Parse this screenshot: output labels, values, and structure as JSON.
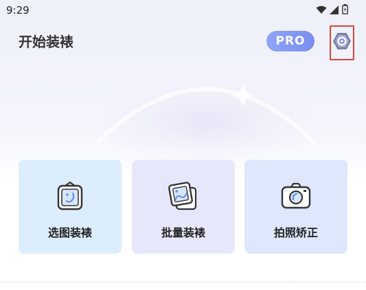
{
  "status_bar": {
    "time": "9:29",
    "icons": [
      "wifi-icon",
      "signal-icon",
      "battery-icon"
    ]
  },
  "header": {
    "title": "开始装裱",
    "pro_label": "PRO",
    "settings_icon": "settings-hex-icon"
  },
  "cards": [
    {
      "label": "选图装裱",
      "icon": "framed-picture-icon"
    },
    {
      "label": "批量装裱",
      "icon": "stacked-photos-icon"
    },
    {
      "label": "拍照矫正",
      "icon": "camera-icon"
    }
  ],
  "colors": {
    "accent": "#7b8cf0",
    "highlight_border": "#d9433a",
    "card_1_bg": "#dcedfd",
    "card_2_bg": "#e7e7fc",
    "card_3_bg": "#dee7fc",
    "icon_stroke": "#333333",
    "icon_accent": "#5a8de8"
  }
}
